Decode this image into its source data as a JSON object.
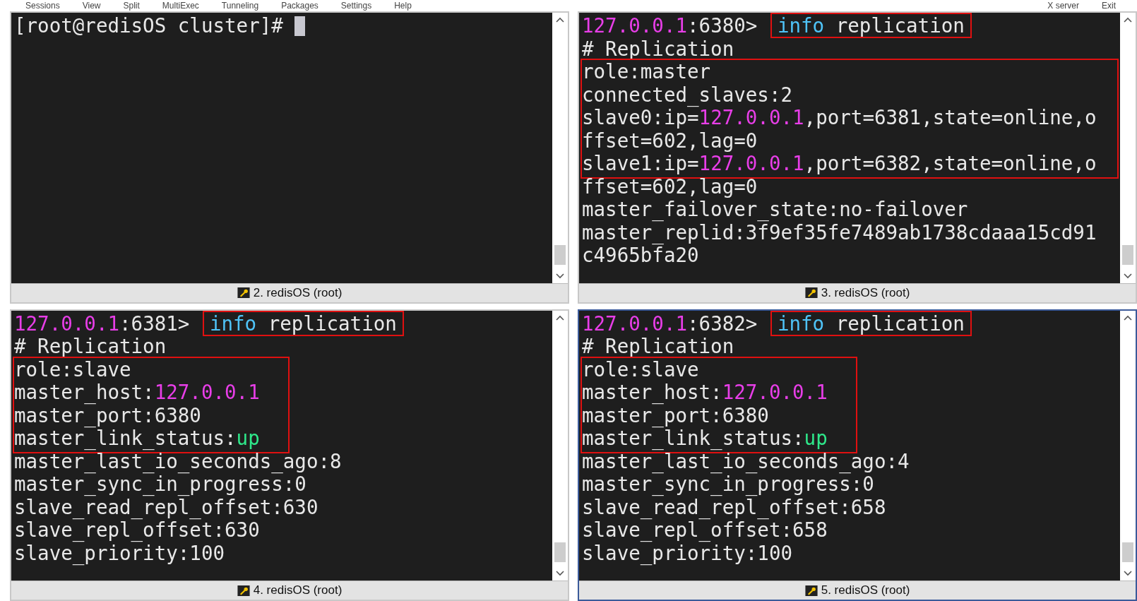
{
  "menu": [
    "Sessions",
    "View",
    "Split",
    "MultiExec",
    "Tunneling",
    "Packages",
    "Settings",
    "Help",
    "X server",
    "Exit"
  ],
  "panes": [
    {
      "title": "2. redisOS (root)",
      "selected": false,
      "cursor": true,
      "blocks": [
        {
          "boxed": false,
          "lines": [
            {
              "segments": [
                {
                  "text": "[root@redisOS cluster]# ",
                  "kind": "text"
                }
              ]
            }
          ]
        }
      ]
    },
    {
      "title": "3. redisOS (root)",
      "selected": false,
      "cursor": false,
      "blocks": [
        {
          "boxed": false,
          "lines": [
            {
              "segments": [
                {
                  "text": "127.0.0.1",
                  "kind": "ip"
                },
                {
                  "text": ":6380> ",
                  "kind": "text"
                }
              ],
              "highlighted": [
                {
                  "text": "info",
                  "kind": "command"
                },
                {
                  "text": " replication",
                  "kind": "text"
                }
              ]
            },
            {
              "segments": [
                {
                  "text": "# Replication",
                  "kind": "text"
                }
              ]
            }
          ]
        },
        {
          "boxed": true,
          "lines": [
            {
              "segments": [
                {
                  "text": "role:master",
                  "kind": "text"
                }
              ]
            },
            {
              "segments": [
                {
                  "text": "connected_slaves:2",
                  "kind": "text"
                }
              ]
            },
            {
              "segments": [
                {
                  "text": "slave0:ip=",
                  "kind": "text"
                },
                {
                  "text": "127.0.0.1",
                  "kind": "ip"
                },
                {
                  "text": ",port=6381,state=online,o",
                  "kind": "text"
                }
              ]
            },
            {
              "segments": [
                {
                  "text": "ffset=602,lag=0",
                  "kind": "text"
                }
              ]
            },
            {
              "segments": [
                {
                  "text": "slave1:ip=",
                  "kind": "text"
                },
                {
                  "text": "127.0.0.1",
                  "kind": "ip"
                },
                {
                  "text": ",port=6382,state=online,o",
                  "kind": "text"
                }
              ]
            }
          ]
        },
        {
          "boxed": false,
          "lines": [
            {
              "segments": [
                {
                  "text": "ffset=602,lag=0",
                  "kind": "text"
                }
              ]
            },
            {
              "segments": [
                {
                  "text": "master_failover_state:no-failover",
                  "kind": "text"
                }
              ]
            },
            {
              "segments": [
                {
                  "text": "master_replid:3f9ef35fe7489ab1738cdaaa15cd91",
                  "kind": "text"
                }
              ]
            },
            {
              "segments": [
                {
                  "text": "c4965bfa20",
                  "kind": "text"
                }
              ]
            }
          ]
        }
      ]
    },
    {
      "title": "4. redisOS (root)",
      "selected": false,
      "cursor": false,
      "blocks": [
        {
          "boxed": false,
          "lines": [
            {
              "segments": [
                {
                  "text": "127.0.0.1",
                  "kind": "ip"
                },
                {
                  "text": ":6381> ",
                  "kind": "text"
                }
              ],
              "highlighted": [
                {
                  "text": "info",
                  "kind": "command"
                },
                {
                  "text": " replication",
                  "kind": "text"
                }
              ]
            },
            {
              "segments": [
                {
                  "text": "# Replication",
                  "kind": "text"
                }
              ]
            }
          ]
        },
        {
          "boxed": true,
          "lines": [
            {
              "segments": [
                {
                  "text": "role:slave",
                  "kind": "text"
                }
              ]
            },
            {
              "segments": [
                {
                  "text": "master_host:",
                  "kind": "text"
                },
                {
                  "text": "127.0.0.1",
                  "kind": "ip"
                }
              ]
            },
            {
              "segments": [
                {
                  "text": "master_port:6380",
                  "kind": "text"
                }
              ]
            },
            {
              "segments": [
                {
                  "text": "master_link_status:",
                  "kind": "text"
                },
                {
                  "text": "up",
                  "kind": "up"
                }
              ]
            }
          ]
        },
        {
          "boxed": false,
          "lines": [
            {
              "segments": [
                {
                  "text": "master_last_io_seconds_ago:8",
                  "kind": "text"
                }
              ]
            },
            {
              "segments": [
                {
                  "text": "master_sync_in_progress:0",
                  "kind": "text"
                }
              ]
            },
            {
              "segments": [
                {
                  "text": "slave_read_repl_offset:630",
                  "kind": "text"
                }
              ]
            },
            {
              "segments": [
                {
                  "text": "slave_repl_offset:630",
                  "kind": "text"
                }
              ]
            },
            {
              "segments": [
                {
                  "text": "slave_priority:100",
                  "kind": "text"
                }
              ]
            }
          ]
        }
      ]
    },
    {
      "title": "5. redisOS (root)",
      "selected": true,
      "cursor": false,
      "blocks": [
        {
          "boxed": false,
          "lines": [
            {
              "segments": [
                {
                  "text": "127.0.0.1",
                  "kind": "ip"
                },
                {
                  "text": ":6382> ",
                  "kind": "text"
                }
              ],
              "highlighted": [
                {
                  "text": "info",
                  "kind": "command"
                },
                {
                  "text": " replication",
                  "kind": "text"
                }
              ]
            },
            {
              "segments": [
                {
                  "text": "# Replication",
                  "kind": "text"
                }
              ]
            }
          ]
        },
        {
          "boxed": true,
          "lines": [
            {
              "segments": [
                {
                  "text": "role:slave",
                  "kind": "text"
                }
              ]
            },
            {
              "segments": [
                {
                  "text": "master_host:",
                  "kind": "text"
                },
                {
                  "text": "127.0.0.1",
                  "kind": "ip"
                }
              ]
            },
            {
              "segments": [
                {
                  "text": "master_port:6380",
                  "kind": "text"
                }
              ]
            },
            {
              "segments": [
                {
                  "text": "master_link_status:",
                  "kind": "text"
                },
                {
                  "text": "up",
                  "kind": "up"
                }
              ]
            }
          ]
        },
        {
          "boxed": false,
          "lines": [
            {
              "segments": [
                {
                  "text": "master_last_io_seconds_ago:4",
                  "kind": "text"
                }
              ]
            },
            {
              "segments": [
                {
                  "text": "master_sync_in_progress:0",
                  "kind": "text"
                }
              ]
            },
            {
              "segments": [
                {
                  "text": "slave_read_repl_offset:658",
                  "kind": "text"
                }
              ]
            },
            {
              "segments": [
                {
                  "text": "slave_repl_offset:658",
                  "kind": "text"
                }
              ]
            },
            {
              "segments": [
                {
                  "text": "slave_priority:100",
                  "kind": "text"
                }
              ]
            }
          ]
        }
      ]
    }
  ]
}
